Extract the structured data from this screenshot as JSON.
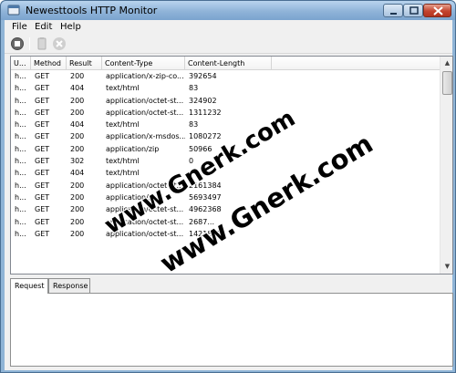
{
  "window": {
    "title": "Newesttools HTTP Monitor"
  },
  "menu": [
    "File",
    "Edit",
    "Help"
  ],
  "toolbar": {
    "buttons": [
      {
        "name": "stop-icon",
        "enabled": true
      },
      {
        "name": "clear-icon",
        "enabled": false
      },
      {
        "name": "delete-icon",
        "enabled": false
      }
    ]
  },
  "table": {
    "columns": [
      "U...",
      "Method",
      "Result",
      "Content-Type",
      "Content-Length"
    ],
    "rows": [
      [
        "h...",
        "GET",
        "200",
        "application/x-zip-co...",
        "392654"
      ],
      [
        "h...",
        "GET",
        "404",
        "text/html",
        "83"
      ],
      [
        "h...",
        "GET",
        "200",
        "application/octet-st...",
        "324902"
      ],
      [
        "h...",
        "GET",
        "200",
        "application/octet-st...",
        "1311232"
      ],
      [
        "h...",
        "GET",
        "404",
        "text/html",
        "83"
      ],
      [
        "h...",
        "GET",
        "200",
        "application/x-msdos...",
        "1080272"
      ],
      [
        "h...",
        "GET",
        "200",
        "application/zip",
        "50966"
      ],
      [
        "h...",
        "GET",
        "302",
        "text/html",
        "0"
      ],
      [
        "h...",
        "GET",
        "404",
        "text/html",
        ""
      ],
      [
        "h...",
        "GET",
        "200",
        "application/octet-st...",
        "2161384"
      ],
      [
        "h...",
        "GET",
        "200",
        "application/x...",
        "5693497"
      ],
      [
        "h...",
        "GET",
        "200",
        "application/octet-st...",
        "4962368"
      ],
      [
        "h...",
        "GET",
        "200",
        "application/octet-st...",
        "2687..."
      ],
      [
        "h...",
        "GET",
        "200",
        "application/octet-st...",
        "1421841"
      ]
    ]
  },
  "tabs": [
    "Request",
    "Response"
  ],
  "watermark": [
    "www.Gnerk.com",
    "www.Gnerk.com"
  ],
  "colors": {
    "titlebar": "#8fb3d8",
    "client": "#f0f0f0",
    "watermark": "#000000"
  }
}
